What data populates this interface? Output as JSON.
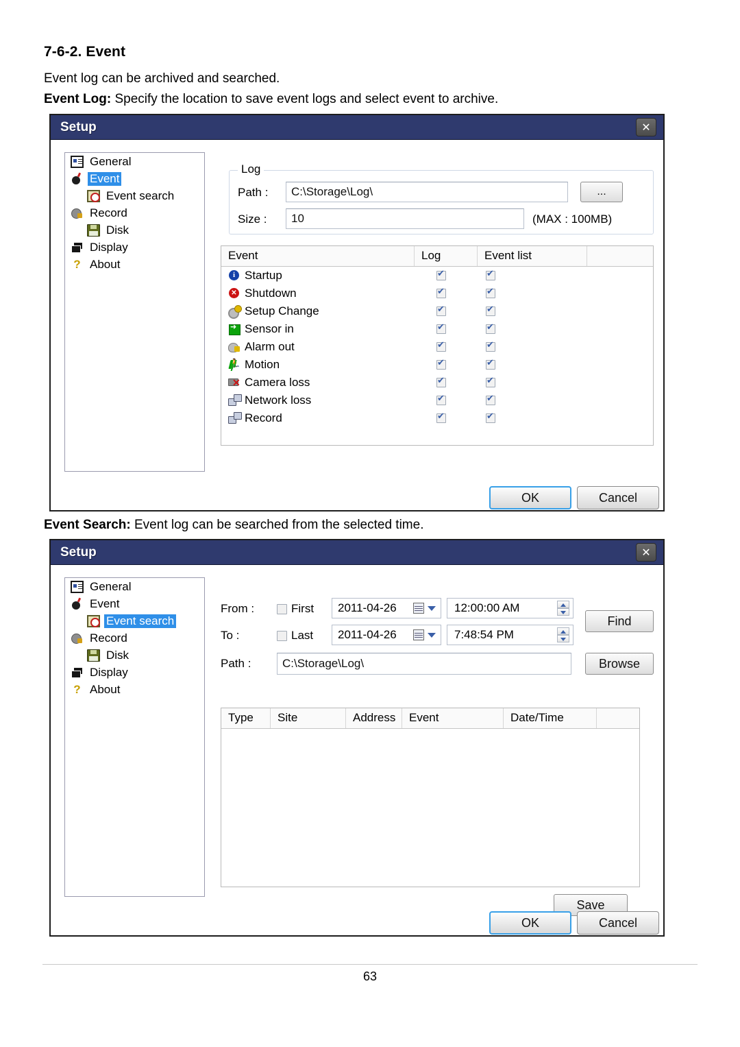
{
  "document": {
    "heading": "7-6-2.  Event",
    "line1": "Event log can be archived and searched.",
    "line2_bold": "Event Log:",
    "line2_rest": " Specify the location to save event logs and select event to archive.",
    "line3_bold": "Event Search:",
    "line3_rest": " Event log can be searched from the selected time.",
    "page_number": "63"
  },
  "colors": {
    "titlebar": "#2f3a6e",
    "selection": "#2f8fe8",
    "focus_border": "#38a0e8",
    "check_blue": "#3a5fa8"
  },
  "dialog1": {
    "title": "Setup",
    "close_label": "✕",
    "sidebar": [
      {
        "label": "General",
        "icon": "general-icon",
        "indent": false,
        "selected": false
      },
      {
        "label": "Event",
        "icon": "event-bomb-icon",
        "indent": false,
        "selected": true
      },
      {
        "label": "Event search",
        "icon": "event-search-icon",
        "indent": true,
        "selected": false
      },
      {
        "label": "Record",
        "icon": "record-reel-icon",
        "indent": false,
        "selected": false
      },
      {
        "label": "Disk",
        "icon": "floppy-disk-icon",
        "indent": true,
        "selected": false
      },
      {
        "label": "Display",
        "icon": "display-monitor-icon",
        "indent": false,
        "selected": false
      },
      {
        "label": "About",
        "icon": "help-question-icon",
        "indent": false,
        "selected": false
      }
    ],
    "log_group": {
      "legend": "Log",
      "path_label": "Path :",
      "path_value": "C:\\Storage\\Log\\",
      "browse_label": "...",
      "size_label": "Size :",
      "size_value": "10",
      "max_note": "(MAX : 100MB)"
    },
    "event_table": {
      "columns": [
        "Event",
        "Log",
        "Event list",
        ""
      ],
      "rows": [
        {
          "name": "Startup",
          "icon": "info-icon",
          "log": true,
          "event_list": true
        },
        {
          "name": "Shutdown",
          "icon": "error-icon",
          "log": true,
          "event_list": true
        },
        {
          "name": "Setup Change",
          "icon": "gears-icon",
          "log": true,
          "event_list": true
        },
        {
          "name": "Sensor in",
          "icon": "sensor-in-icon",
          "log": true,
          "event_list": true
        },
        {
          "name": "Alarm out",
          "icon": "alarm-out-icon",
          "log": true,
          "event_list": true
        },
        {
          "name": "Motion",
          "icon": "motion-icon",
          "log": true,
          "event_list": true
        },
        {
          "name": "Camera loss",
          "icon": "camera-loss-icon",
          "log": true,
          "event_list": true
        },
        {
          "name": "Network loss",
          "icon": "network-loss-icon",
          "log": true,
          "event_list": true
        },
        {
          "name": "Record",
          "icon": "network-record-icon",
          "log": true,
          "event_list": true
        }
      ]
    },
    "ok_label": "OK",
    "cancel_label": "Cancel"
  },
  "dialog2": {
    "title": "Setup",
    "close_label": "✕",
    "sidebar": [
      {
        "label": "General",
        "icon": "general-icon",
        "indent": false,
        "selected": false
      },
      {
        "label": "Event",
        "icon": "event-bomb-icon",
        "indent": false,
        "selected": false
      },
      {
        "label": "Event search",
        "icon": "event-search-icon",
        "indent": true,
        "selected": true
      },
      {
        "label": "Record",
        "icon": "record-reel-icon",
        "indent": false,
        "selected": false
      },
      {
        "label": "Disk",
        "icon": "floppy-disk-icon",
        "indent": true,
        "selected": false
      },
      {
        "label": "Display",
        "icon": "display-monitor-icon",
        "indent": false,
        "selected": false
      },
      {
        "label": "About",
        "icon": "help-question-icon",
        "indent": false,
        "selected": false
      }
    ],
    "search": {
      "from_label": "From :",
      "first_checkbox_label": "First",
      "first_checked": false,
      "from_date": "2011-04-26",
      "from_time": "12:00:00 AM",
      "to_label": "To :",
      "last_checkbox_label": "Last",
      "last_checked": false,
      "to_date": "2011-04-26",
      "to_time": "7:48:54 PM",
      "path_label": "Path  :",
      "path_value": "C:\\Storage\\Log\\",
      "find_label": "Find",
      "browse_label": "Browse"
    },
    "results_table": {
      "columns": [
        "Type",
        "Site",
        "Address",
        "Event",
        "Date/Time",
        ""
      ],
      "rows": []
    },
    "save_label": "Save",
    "ok_label": "OK",
    "cancel_label": "Cancel"
  }
}
